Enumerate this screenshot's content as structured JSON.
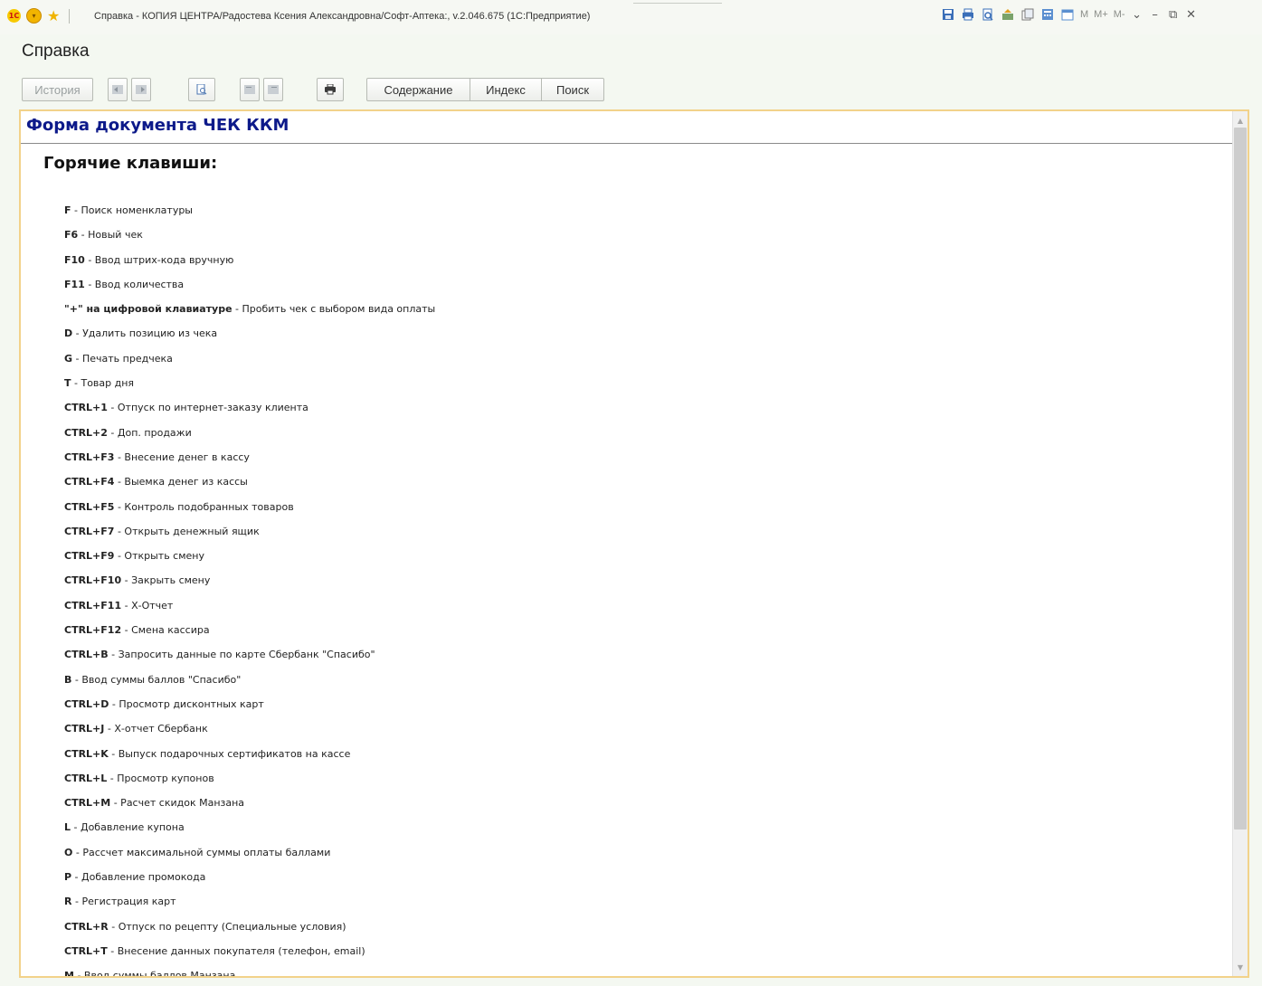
{
  "window": {
    "title": "Справка - КОПИЯ ЦЕНТРА/Радостева Ксения Александровна/Софт-Аптека:, v.2.046.675  (1С:Предприятие)",
    "logo_text": "1С",
    "memory_buttons": [
      "M",
      "M+",
      "M-"
    ]
  },
  "header": {
    "title": "Справка"
  },
  "toolbar": {
    "history_label": "История",
    "tabs": [
      {
        "label": "Содержание"
      },
      {
        "label": "Индекс"
      },
      {
        "label": "Поиск"
      }
    ]
  },
  "document": {
    "title": "Форма документа ЧЕК ККМ",
    "section_title": "Горячие клавиши:",
    "hotkeys": [
      {
        "key": "F",
        "desc": " - Поиск номенклатуры"
      },
      {
        "key": "F6",
        "desc": " - Новый чек"
      },
      {
        "key": "F10",
        "desc": " - Ввод штрих-кода вручную"
      },
      {
        "key": "F11",
        "desc": " - Ввод количества"
      },
      {
        "key": "\"+\" на цифровой клавиатуре",
        "desc": " - Пробить чек с выбором вида оплаты"
      },
      {
        "key": "D",
        "desc": " - Удалить позицию из чека"
      },
      {
        "key": "G",
        "desc": " - Печать предчека"
      },
      {
        "key": "T",
        "desc": " - Товар дня"
      },
      {
        "key": "CTRL+1",
        "desc": " - Отпуск по интернет-заказу клиента"
      },
      {
        "key": "CTRL+2",
        "desc": " - Доп. продажи"
      },
      {
        "key": "CTRL+F3",
        "desc": " - Внесение денег в кассу"
      },
      {
        "key": "CTRL+F4",
        "desc": " - Выемка денег из кассы"
      },
      {
        "key": "CTRL+F5",
        "desc": " - Контроль подобранных товаров"
      },
      {
        "key": "CTRL+F7",
        "desc": " - Открыть денежный ящик"
      },
      {
        "key": "CTRL+F9",
        "desc": " - Открыть смену"
      },
      {
        "key": "CTRL+F10",
        "desc": " - Закрыть смену"
      },
      {
        "key": "CTRL+F11",
        "desc": " - Х-Отчет"
      },
      {
        "key": "CTRL+F12",
        "desc": " - Смена кассира"
      },
      {
        "key": "CTRL+B",
        "desc": " - Запросить данные по карте Сбербанк \"Спасибо\""
      },
      {
        "key": "B",
        "desc": " - Ввод суммы баллов \"Спасибо\""
      },
      {
        "key": "CTRL+D",
        "desc": " - Просмотр дисконтных карт"
      },
      {
        "key": "CTRL+J",
        "desc": " - Х-отчет Сбербанк"
      },
      {
        "key": "CTRL+K",
        "desc": " - Выпуск подарочных сертификатов на кассе"
      },
      {
        "key": "CTRL+L",
        "desc": " - Просмотр купонов"
      },
      {
        "key": "CTRL+M",
        "desc": " - Расчет скидок Манзана"
      },
      {
        "key": "L",
        "desc": " - Добавление купона"
      },
      {
        "key": "O",
        "desc": " - Рассчет максимальной суммы оплаты баллами"
      },
      {
        "key": "P",
        "desc": " - Добавление промокода"
      },
      {
        "key": "R",
        "desc": " - Регистрация карт"
      },
      {
        "key": "CTRL+R",
        "desc": " - Отпуск по рецепту (Специальные условия)"
      },
      {
        "key": "CTRL+T",
        "desc": " - Внесение данных покупателя (телефон, email)"
      },
      {
        "key": "M",
        "desc": " - Ввод суммы баллов Манзана"
      }
    ]
  },
  "colors": {
    "background": "#f4f8f1",
    "doc_title": "#0d1a8a",
    "frame_border": "#f2d28a"
  }
}
